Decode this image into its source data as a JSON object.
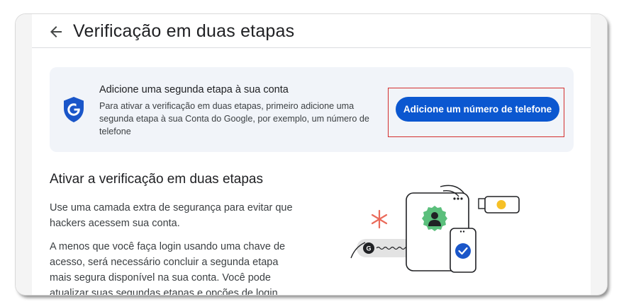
{
  "header": {
    "title": "Verificação em duas etapas"
  },
  "card": {
    "title": "Adicione uma segunda etapa à sua conta",
    "text": "Para ativar a verificação em duas etapas, primeiro adicione uma segunda etapa à sua Conta do Google, por exemplo, um número de telefone",
    "button_label": "Adicione um número de telefone"
  },
  "section": {
    "title": "Ativar a verificação em duas etapas",
    "paragraph1": "Use uma camada extra de segurança para evitar que hackers acessem sua conta.",
    "paragraph2": "A menos que você faça login usando uma chave de acesso, será necessário concluir a segunda etapa mais segura disponível na sua conta. Você pode atualizar suas segundas etapas e opções de login nas"
  },
  "colors": {
    "accent": "#0b57d0",
    "card_background": "#f1f4f9",
    "highlight_border": "#d32f2f"
  },
  "icons": {
    "back": "arrow-back-icon",
    "shield": "google-shield-icon"
  }
}
